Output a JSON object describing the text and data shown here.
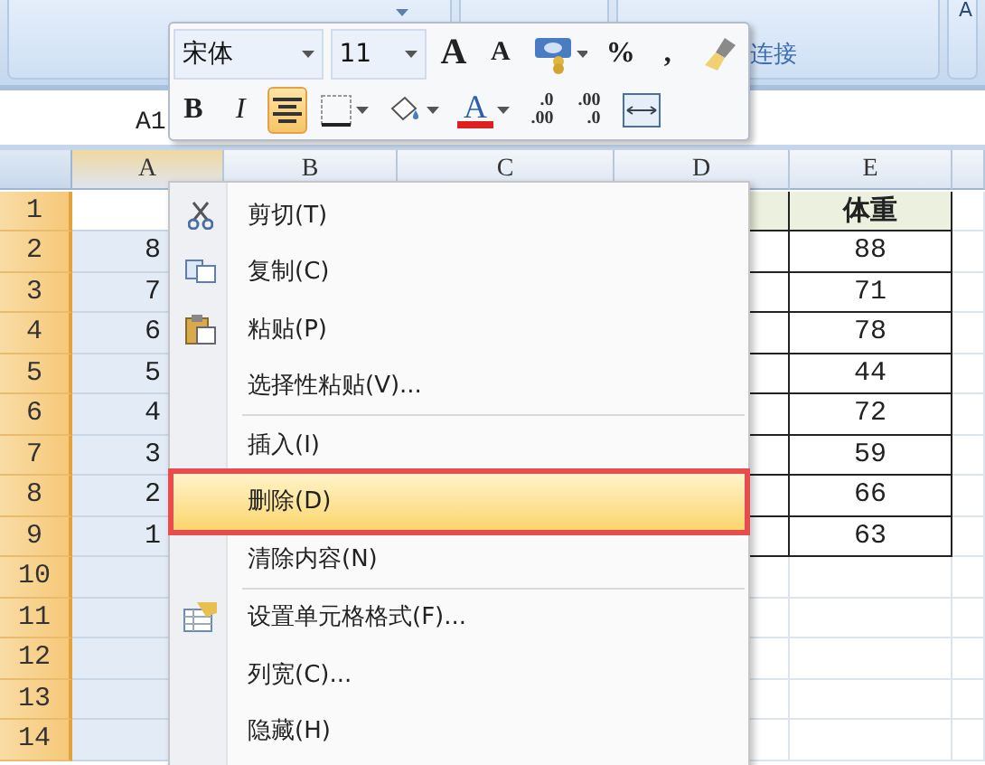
{
  "ribbon": {
    "group_label": "连接",
    "corner_letter": "A"
  },
  "name_box": {
    "value": "A1"
  },
  "mini_toolbar": {
    "font": "宋体",
    "size": "11",
    "row_1": [
      {
        "kind": "grow",
        "text": "A"
      },
      {
        "kind": "shrink",
        "text": "A"
      },
      {
        "kind": "accounting"
      },
      {
        "kind": "text",
        "text": "%"
      },
      {
        "kind": "text",
        "text": ","
      },
      {
        "kind": "painter"
      }
    ],
    "row_2": [
      {
        "kind": "bold",
        "text": "B",
        "selected": false
      },
      {
        "kind": "italic",
        "text": "I",
        "selected": false
      },
      {
        "kind": "center",
        "selected": true
      },
      {
        "kind": "borders"
      },
      {
        "kind": "fill"
      },
      {
        "kind": "fontcolor",
        "text": "A",
        "color": "#e02020"
      },
      {
        "kind": "decimal",
        "text": ".0",
        "text_2": ".00"
      },
      {
        "kind": "decimal",
        "text": ".00",
        "text_2": ".0"
      },
      {
        "kind": "merge"
      }
    ]
  },
  "columns": [
    {
      "label": "A",
      "selected": true
    },
    {
      "label": "B",
      "selected": false
    },
    {
      "label": "C",
      "selected": false
    },
    {
      "label": "D",
      "selected": false
    },
    {
      "label": "E",
      "selected": false
    }
  ],
  "rows": [
    {
      "header": "1",
      "e": "体重",
      "active": true
    },
    {
      "header": "2",
      "a": "8",
      "e": "88"
    },
    {
      "header": "3",
      "a": "7",
      "e": "71"
    },
    {
      "header": "4",
      "a": "6",
      "e": "78"
    },
    {
      "header": "5",
      "a": "5",
      "e": "44"
    },
    {
      "header": "6",
      "a": "4",
      "e": "72"
    },
    {
      "header": "7",
      "a": "3",
      "e": "59"
    },
    {
      "header": "8",
      "a": "2",
      "e": "66"
    },
    {
      "header": "9",
      "a": "1",
      "e": "63"
    },
    {
      "header": "10"
    },
    {
      "header": "11"
    },
    {
      "header": "12"
    },
    {
      "header": "13"
    },
    {
      "header": "14"
    }
  ],
  "context_menu": [
    {
      "kind": "cut",
      "label": "剪切(T)",
      "selected": false
    },
    {
      "kind": "copy",
      "label": "复制(C)",
      "selected": false
    },
    {
      "kind": "paste",
      "label": "粘贴(P)",
      "selected": false
    },
    {
      "kind": "plain",
      "label": "选择性粘贴(V)...",
      "selected": false
    },
    {
      "kind": "separator"
    },
    {
      "kind": "plain",
      "label": "插入(I)",
      "selected": false
    },
    {
      "kind": "plain",
      "label": "删除(D)",
      "selected": true
    },
    {
      "kind": "plain",
      "label": "清除内容(N)",
      "selected": false
    },
    {
      "kind": "separator"
    },
    {
      "kind": "format",
      "label": "设置单元格格式(F)...",
      "selected": false
    },
    {
      "kind": "plain",
      "label": "列宽(C)...",
      "selected": false
    },
    {
      "kind": "plain",
      "label": "隐藏(H)",
      "selected": false
    }
  ]
}
